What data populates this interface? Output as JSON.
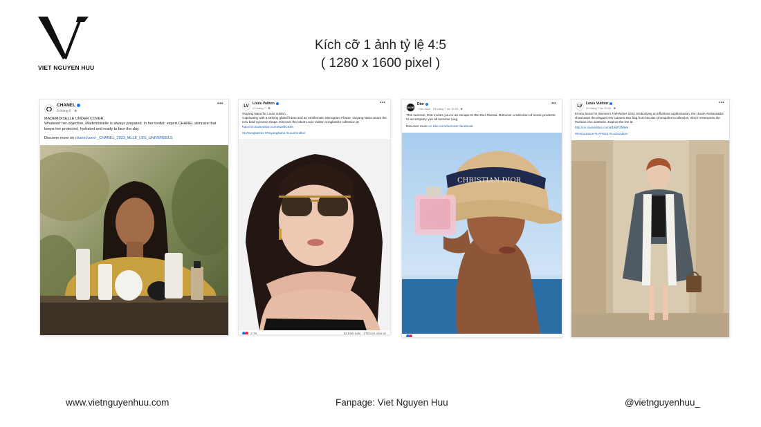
{
  "brand": {
    "name": "VIET NGUYEN HUU"
  },
  "title": {
    "line1": "Kích cỡ 1 ảnh tỷ lệ 4:5",
    "line2": "( 1280 x 1600 pixel )"
  },
  "posts": [
    {
      "page": "CHANEL",
      "meta": "9 tháng 6 · ",
      "text": "MADEMOISELLE UNDER COVER.\nWhatever her objective, Mademoiselle is always prepared. In her toolkit: expert CHANEL skincare that keeps her protected, hydrated and ready to face the day.",
      "discover": "Discover more on ",
      "link": "chanel.com/-_CHANEL_2023_MLLE_LES_UNIVERSELS"
    },
    {
      "page": "Louis Vuitton",
      "meta": "23 tháng 7 · ",
      "text": "Ouyang Nana for Louis Vuitton.\nCaptivating with a striking gilded frame and an emblematic Monogram Flower, Ouyang Nana wears the new bold eyewear shape. Discover the latest Louis Vuitton sunglasses collection at",
      "link": "http://on.louisvuitton.com/6180C6SK",
      "tags": "#LVSunglasses #OuyangNana #LouisVuitton",
      "reactions": "2,7K",
      "stats": "53 bình luận · 176 lượt chia sẻ"
    },
    {
      "page": "Dior",
      "meta": "· Yêu thích · 23 tháng 7 lúc 15:59 · ",
      "text": "This summer, Dior invites you to an escape to the Dior Riviera. Discover a selection of iconic products to accompany you all summer long.",
      "discover": "Discover more ",
      "link": "on dior.com/summer-facebook"
    },
    {
      "page": "Louis Vuitton",
      "meta": "20 tháng 7 lúc 20:00 · ",
      "text": "Emma Stone for Women's Fall-Winter 2023. Embodying an effortless sophistication, the House Ambassador showcases the elegant new Camera Box bag from Nicolas Ghesquière's collection, which reinterprets the Parisian-chic aesthetic. Explore the line at",
      "link": "http://on.louisvuitton.com/6186PZMWe",
      "tags": "#EmmaStone #LVFW23 #LouisVuitton"
    }
  ],
  "footer": {
    "website": "www.vietnguyenhuu.com",
    "fanpage": "Fanpage: Viet Nguyen Huu",
    "handle": "@vietnguyenhuu_"
  },
  "colors": {
    "link": "#1a5fb4",
    "verified": "#1877f2",
    "text": "#222222"
  }
}
